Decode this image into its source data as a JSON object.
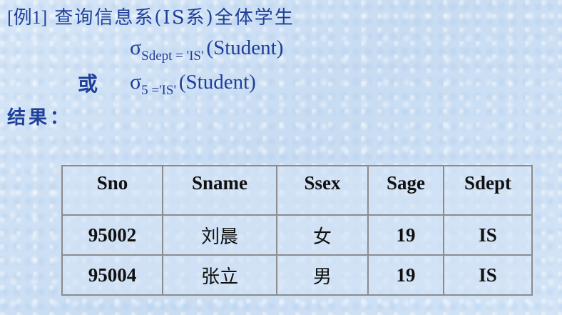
{
  "title": {
    "example_label": "[例1]",
    "text": "查询信息系(IS系)全体学生"
  },
  "formula1": {
    "sigma": "σ",
    "subscript": "Sdept = 'IS'",
    "argument": "(Student)"
  },
  "or_label": "或",
  "formula2": {
    "sigma": "σ",
    "subscript": "5 ='IS'",
    "argument": "(Student)"
  },
  "result_label": "结果：",
  "table": {
    "headers": [
      "Sno",
      "Sname",
      "Ssex",
      "Sage",
      "Sdept"
    ],
    "rows": [
      [
        "95002",
        "刘晨",
        "女",
        "19",
        "IS"
      ],
      [
        "95004",
        "张立",
        "男",
        "19",
        "IS"
      ]
    ]
  }
}
